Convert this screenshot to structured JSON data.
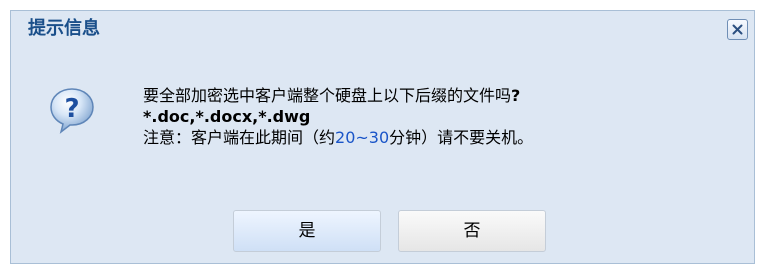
{
  "dialog": {
    "title": "提示信息",
    "close_label": "×"
  },
  "message": {
    "line1": "要全部加密选中客户端整个硬盘上以下后缀的文件吗",
    "line1_qmark": "?",
    "line2": "*.doc,*.docx,*.dwg",
    "line3_prefix": "注意：客户端在此期间（约",
    "line3_range": "20~30",
    "line3_suffix": "分钟）请不要关机。"
  },
  "buttons": {
    "yes": "是",
    "no": "否"
  },
  "colors": {
    "dialog_bg": "#dde7f3",
    "title": "#1a4f8a",
    "highlight": "#1a55c8"
  },
  "icons": {
    "question": "question-icon",
    "close": "close-icon"
  }
}
